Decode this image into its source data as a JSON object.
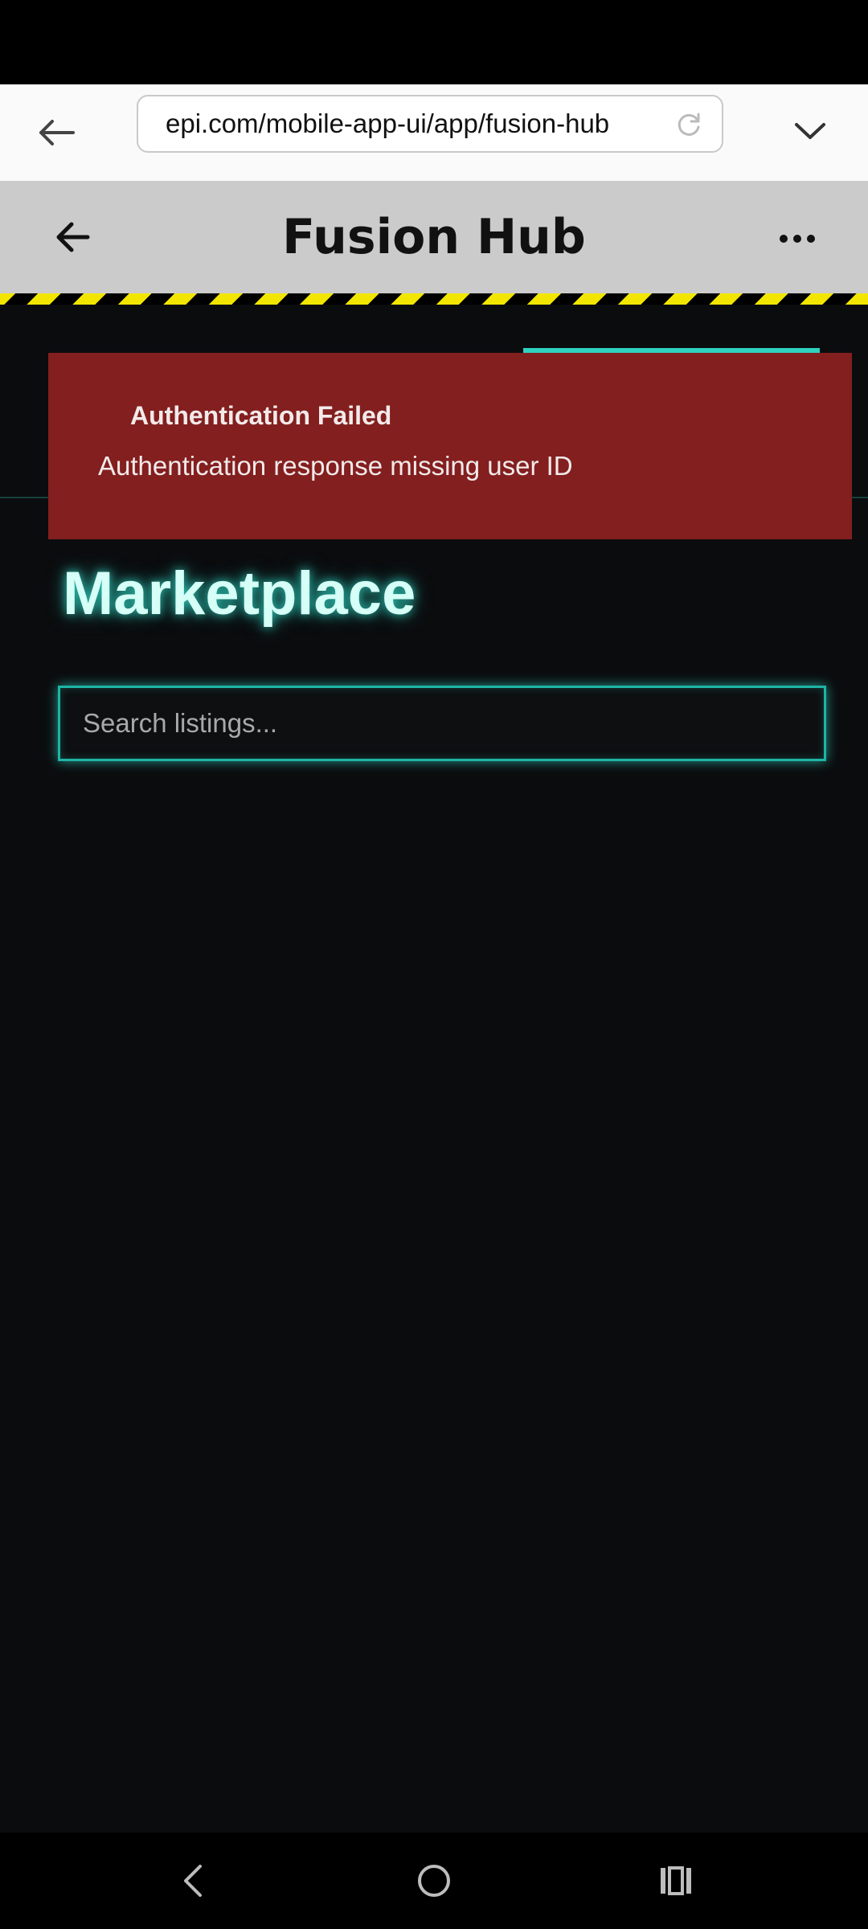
{
  "browser": {
    "url": "epi.com/mobile-app-ui/app/fusion-hub"
  },
  "header": {
    "title": "Fusion Hub"
  },
  "error": {
    "title": "Authentication Failed",
    "message": "Authentication response missing user ID"
  },
  "main": {
    "title": "Marketplace",
    "search_placeholder": "Search listings..."
  },
  "icons": {
    "browser_back": "arrow-left-icon",
    "reload": "reload-icon",
    "tabs": "chevron-down-icon",
    "header_back": "arrow-left-icon",
    "more": "more-horizontal-icon",
    "nav_back": "chevron-left-icon",
    "nav_home": "circle-home-icon",
    "nav_recents": "recents-icon"
  },
  "colors": {
    "accent": "#2fd1bf",
    "error_bg": "#831f1f",
    "background": "#0b0c0e",
    "hazard_yellow": "#f2e600"
  }
}
